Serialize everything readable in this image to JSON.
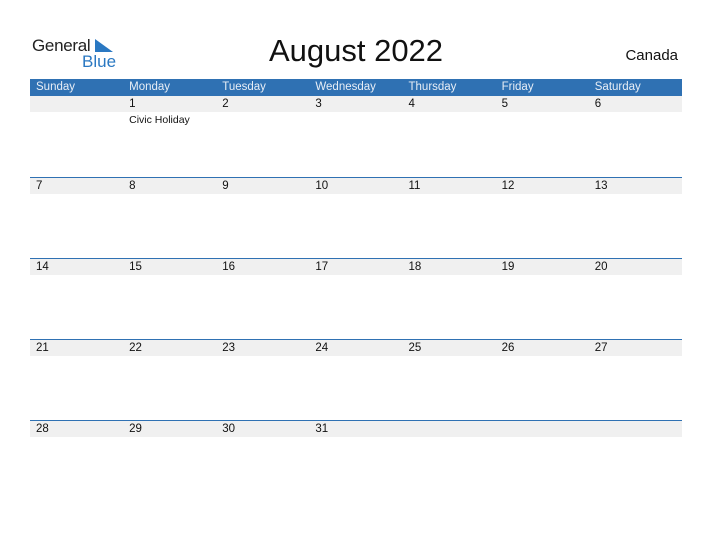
{
  "logo": {
    "general": "General",
    "blue": "Blue"
  },
  "title": "August 2022",
  "country": "Canada",
  "colors": {
    "accent": "#2f71b3",
    "strip": "#f0f0f0"
  },
  "weekdays": [
    "Sunday",
    "Monday",
    "Tuesday",
    "Wednesday",
    "Thursday",
    "Friday",
    "Saturday"
  ],
  "weeks": [
    {
      "days": [
        {
          "num": "",
          "event": ""
        },
        {
          "num": "1",
          "event": "Civic Holiday"
        },
        {
          "num": "2",
          "event": ""
        },
        {
          "num": "3",
          "event": ""
        },
        {
          "num": "4",
          "event": ""
        },
        {
          "num": "5",
          "event": ""
        },
        {
          "num": "6",
          "event": ""
        }
      ]
    },
    {
      "days": [
        {
          "num": "7",
          "event": ""
        },
        {
          "num": "8",
          "event": ""
        },
        {
          "num": "9",
          "event": ""
        },
        {
          "num": "10",
          "event": ""
        },
        {
          "num": "11",
          "event": ""
        },
        {
          "num": "12",
          "event": ""
        },
        {
          "num": "13",
          "event": ""
        }
      ]
    },
    {
      "days": [
        {
          "num": "14",
          "event": ""
        },
        {
          "num": "15",
          "event": ""
        },
        {
          "num": "16",
          "event": ""
        },
        {
          "num": "17",
          "event": ""
        },
        {
          "num": "18",
          "event": ""
        },
        {
          "num": "19",
          "event": ""
        },
        {
          "num": "20",
          "event": ""
        }
      ]
    },
    {
      "days": [
        {
          "num": "21",
          "event": ""
        },
        {
          "num": "22",
          "event": ""
        },
        {
          "num": "23",
          "event": ""
        },
        {
          "num": "24",
          "event": ""
        },
        {
          "num": "25",
          "event": ""
        },
        {
          "num": "26",
          "event": ""
        },
        {
          "num": "27",
          "event": ""
        }
      ]
    },
    {
      "days": [
        {
          "num": "28",
          "event": ""
        },
        {
          "num": "29",
          "event": ""
        },
        {
          "num": "30",
          "event": ""
        },
        {
          "num": "31",
          "event": ""
        },
        {
          "num": "",
          "event": ""
        },
        {
          "num": "",
          "event": ""
        },
        {
          "num": "",
          "event": ""
        }
      ]
    }
  ]
}
